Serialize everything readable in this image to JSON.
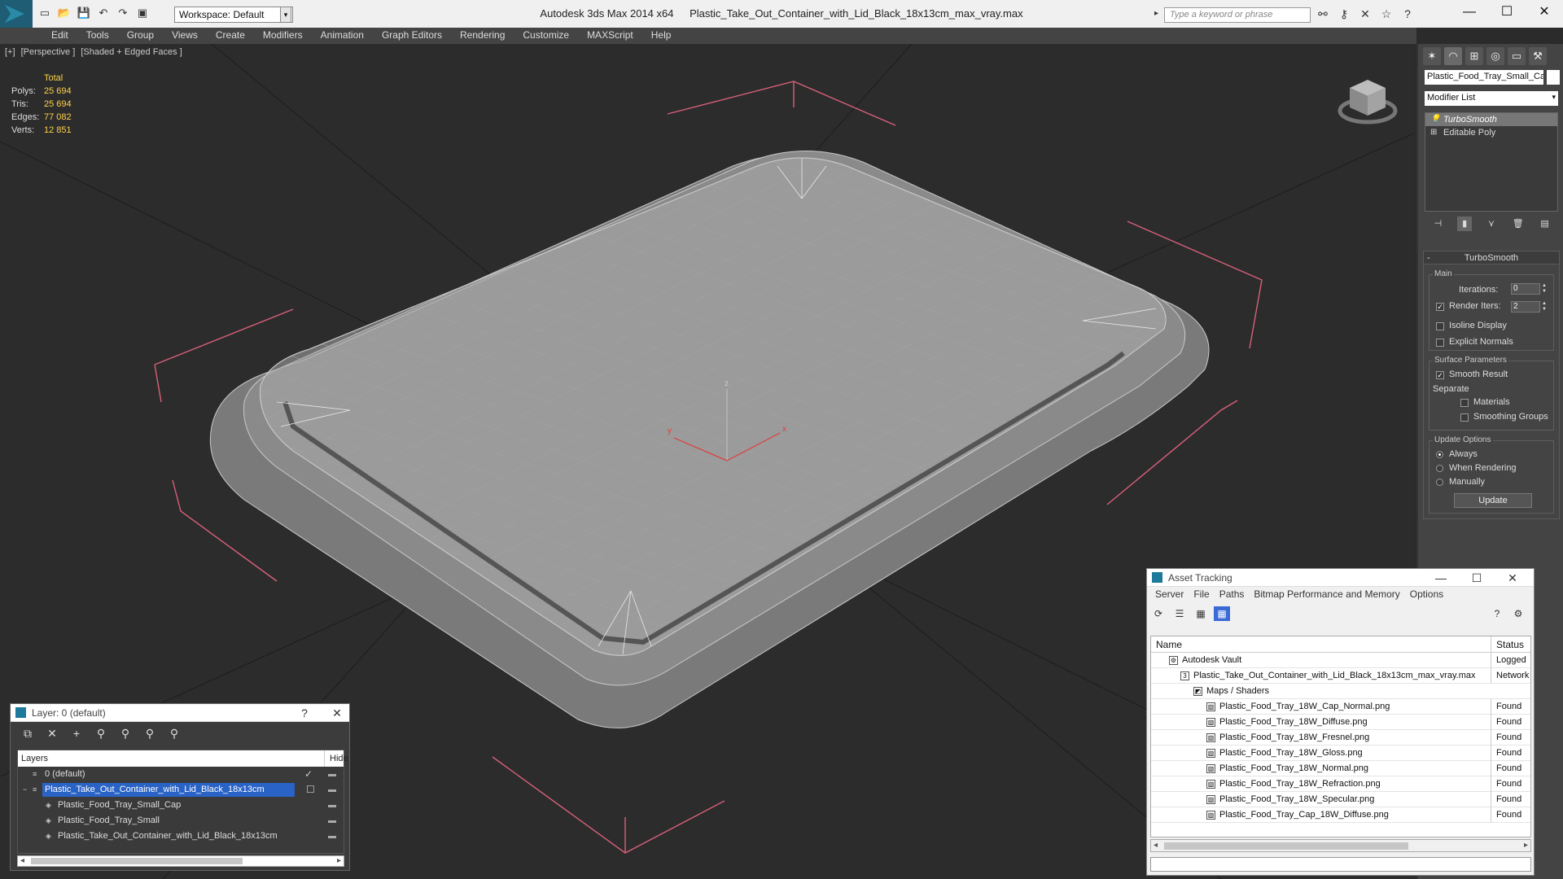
{
  "titlebar": {
    "app_name": "Autodesk 3ds Max  2014 x64",
    "file_name": "Plastic_Take_Out_Container_with_Lid_Black_18x13cm_max_vray.max",
    "workspace": "Workspace: Default",
    "search_placeholder": "Type a keyword or phrase"
  },
  "menu": [
    "Edit",
    "Tools",
    "Group",
    "Views",
    "Create",
    "Modifiers",
    "Animation",
    "Graph Editors",
    "Rendering",
    "Customize",
    "MAXScript",
    "Help"
  ],
  "viewport": {
    "label_parts": [
      "[+]",
      "[Perspective ]",
      "[Shaded + Edged Faces ]"
    ],
    "stats_header": "Total",
    "stats": [
      {
        "key": "Polys:",
        "value": "25 694"
      },
      {
        "key": "Tris:",
        "value": "25 694"
      },
      {
        "key": "Edges:",
        "value": "77 082"
      },
      {
        "key": "Verts:",
        "value": "12 851"
      }
    ],
    "axis_labels": {
      "x": "x",
      "y": "y",
      "z": "z"
    }
  },
  "command_panel": {
    "object_name": "Plastic_Food_Tray_Small_Cap",
    "modifier_list": "Modifier List",
    "stack": [
      "TurboSmooth",
      "Editable Poly"
    ],
    "rollout_title": "TurboSmooth",
    "main_group": "Main",
    "iterations_label": "Iterations:",
    "iterations_value": "0",
    "render_iters_label": "Render Iters:",
    "render_iters_value": "2",
    "isoline_label": "Isoline Display",
    "explicit_normals_label": "Explicit Normals",
    "surface_group": "Surface Parameters",
    "smooth_result_label": "Smooth Result",
    "separate_label": "Separate",
    "materials_label": "Materials",
    "smoothing_groups_label": "Smoothing Groups",
    "update_group": "Update Options",
    "always_label": "Always",
    "when_rendering_label": "When Rendering",
    "manually_label": "Manually",
    "update_button": "Update"
  },
  "layer_window": {
    "title": "Layer: 0 (default)",
    "help": "?",
    "col_layers": "Layers",
    "col_hide": "Hide",
    "rows": [
      {
        "name": "0 (default)",
        "indent": 0,
        "selected": false
      },
      {
        "name": "Plastic_Take_Out_Container_with_Lid_Black_18x13cm",
        "indent": 0,
        "selected": true
      },
      {
        "name": "Plastic_Food_Tray_Small_Cap",
        "indent": 1,
        "selected": false
      },
      {
        "name": "Plastic_Food_Tray_Small",
        "indent": 1,
        "selected": false
      },
      {
        "name": "Plastic_Take_Out_Container_with_Lid_Black_18x13cm",
        "indent": 1,
        "selected": false
      }
    ]
  },
  "asset_window": {
    "title": "Asset Tracking",
    "menu": [
      "Server",
      "File",
      "Paths",
      "Bitmap Performance and Memory",
      "Options"
    ],
    "col_name": "Name",
    "col_status": "Status",
    "rows": [
      {
        "name": "Autodesk Vault",
        "status": "Logged",
        "level": 0
      },
      {
        "name": "Plastic_Take_Out_Container_with_Lid_Black_18x13cm_max_vray.max",
        "status": "Network",
        "level": 1
      },
      {
        "name": "Maps / Shaders",
        "status": "",
        "level": 2
      },
      {
        "name": "Plastic_Food_Tray_18W_Cap_Normal.png",
        "status": "Found",
        "level": 3
      },
      {
        "name": "Plastic_Food_Tray_18W_Diffuse.png",
        "status": "Found",
        "level": 3
      },
      {
        "name": "Plastic_Food_Tray_18W_Fresnel.png",
        "status": "Found",
        "level": 3
      },
      {
        "name": "Plastic_Food_Tray_18W_Gloss.png",
        "status": "Found",
        "level": 3
      },
      {
        "name": "Plastic_Food_Tray_18W_Normal.png",
        "status": "Found",
        "level": 3
      },
      {
        "name": "Plastic_Food_Tray_18W_Refraction.png",
        "status": "Found",
        "level": 3
      },
      {
        "name": "Plastic_Food_Tray_18W_Specular.png",
        "status": "Found",
        "level": 3
      },
      {
        "name": "Plastic_Food_Tray_Cap_18W_Diffuse.png",
        "status": "Found",
        "level": 3
      }
    ]
  }
}
